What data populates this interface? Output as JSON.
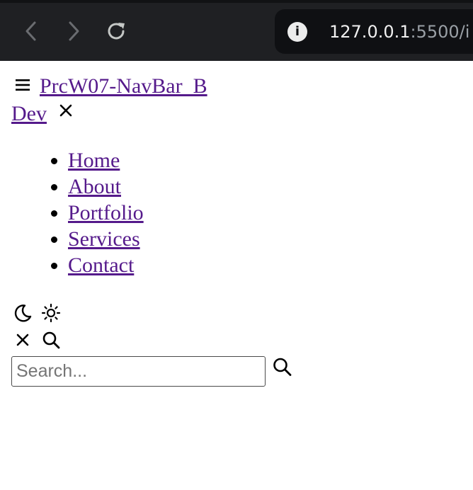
{
  "browser": {
    "url_host": "127.0.0.1",
    "url_rest": ":5500/i",
    "icons": {
      "back": "chevron-left-icon",
      "forward": "chevron-right-icon",
      "reload": "reload-icon",
      "site_info": "info-icon"
    }
  },
  "navbar": {
    "brand": "PrcW07-NavBar_B Dev",
    "menu_items": [
      {
        "label": "Home"
      },
      {
        "label": "About"
      },
      {
        "label": "Portfolio"
      },
      {
        "label": "Services"
      },
      {
        "label": "Contact"
      }
    ],
    "search": {
      "placeholder": "Search...",
      "value": ""
    },
    "icons": {
      "menu": "hamburger-icon",
      "close_menu": "close-icon",
      "dark_mode": "moon-icon",
      "light_mode": "sun-icon",
      "close_search": "close-icon",
      "open_search": "search-icon",
      "submit_search": "search-icon"
    }
  },
  "colors": {
    "browser_bar": "#1f2023",
    "address_bar": "#0f1013",
    "link": "#551a8b"
  }
}
